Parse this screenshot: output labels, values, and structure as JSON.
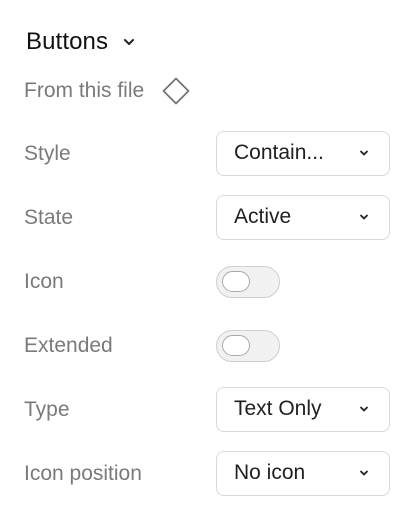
{
  "section": {
    "title": "Buttons",
    "toggle_icon": "chevron-down-icon"
  },
  "source": {
    "label": "From this file",
    "icon": "component-diamond-icon"
  },
  "properties": {
    "style": {
      "label": "Style",
      "value": "Contain..."
    },
    "state": {
      "label": "State",
      "value": "Active"
    },
    "icon": {
      "label": "Icon",
      "checked": false
    },
    "extended": {
      "label": "Extended",
      "checked": false
    },
    "type": {
      "label": "Type",
      "value": "Text Only"
    },
    "icon_position": {
      "label": "Icon position",
      "value": "No icon"
    }
  },
  "colors": {
    "label": "#7a7a7a",
    "text": "#1f1f1f",
    "border": "#d8d8d8",
    "toggle_track": "#f1f1f1"
  }
}
